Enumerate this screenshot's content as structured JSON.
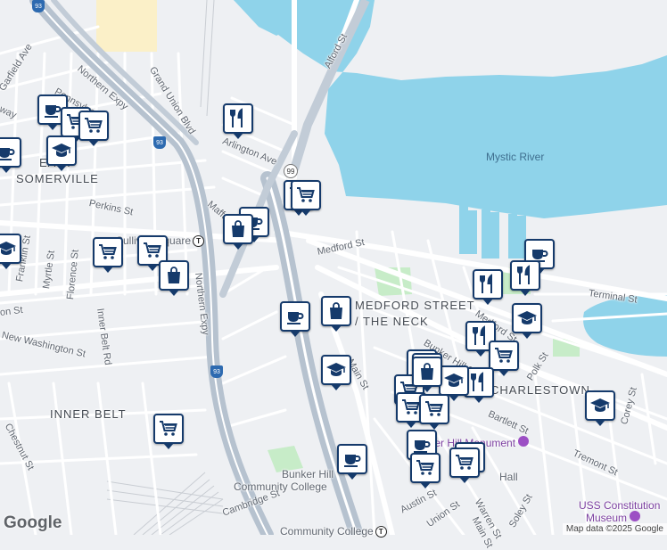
{
  "labels": {
    "mystic_river": "Mystic River",
    "somerville_line1": "EAST",
    "somerville_line2": "SOMERVILLE",
    "inner_belt": "INNER BELT",
    "medford_street_area_line1": "MEDFORD STREET",
    "medford_street_area_line2": "/ THE NECK",
    "charlestown": "CHARLESTOWN",
    "bunker_hill_cc_line1": "Bunker Hill",
    "bunker_hill_cc_line2": "Community College",
    "community_college_station": "Community College",
    "sullivan_square": "Sullivan Square",
    "monument": "Bunker Hill Monument",
    "uss_museum_line1": "USS Constitution",
    "uss_museum_line2": "Museum",
    "city_square_fragment": "Hall",
    "route_99": "99",
    "route_93": "93"
  },
  "streets": {
    "northern_expy_1": "Northern Expy",
    "northern_expy_2": "Northern Expy",
    "grand_union_blvd": "Grand Union Blvd",
    "alford_st": "Alford St",
    "arlington_ave": "Arlington Ave",
    "perkins_st": "Perkins St",
    "garfield_ave": "Garfield Ave",
    "pennsylvania": "Pennsylvania",
    "franklin_st": "Franklin St",
    "myrtle_st": "Myrtle St",
    "florence_st": "Florence St",
    "inner_belt_rd": "Inner Belt Rd",
    "new_washington_st": "New Washington St",
    "washington_st": "on St",
    "medford_st": "Medford St",
    "medford_st_2": "Medford St",
    "bunker_hill_st": "Bunker Hill St",
    "main_st": "Main St",
    "main_st_2": "Main St",
    "terminal_st": "Terminal St",
    "polk_st": "Polk St",
    "bartlett_st": "Bartlett St",
    "tremont_st": "Tremont St",
    "corey_st": "Corey St",
    "austin_st": "Austin St",
    "union_st": "Union St",
    "warren_st": "Warren St",
    "soley_st": "Soley St",
    "chestnut_st": "Chestnut St",
    "maffa_way": "Maffa",
    "broadway_fragment": "way",
    "cambridge_st": "Cambridge St"
  },
  "pins": [
    {
      "icon": "coffee"
    },
    {
      "icon": "cart"
    },
    {
      "icon": "cart"
    },
    {
      "icon": "school"
    },
    {
      "icon": "restaurant"
    },
    {
      "icon": "cart"
    },
    {
      "icon": "cart"
    },
    {
      "icon": "coffee"
    },
    {
      "icon": "shopping-bag"
    },
    {
      "icon": "cart"
    },
    {
      "icon": "cart"
    },
    {
      "icon": "shopping-bag"
    },
    {
      "icon": "coffee"
    },
    {
      "icon": "shopping-bag"
    },
    {
      "icon": "school"
    },
    {
      "icon": "coffee"
    },
    {
      "icon": "restaurant"
    },
    {
      "icon": "restaurant"
    },
    {
      "icon": "coffee"
    },
    {
      "icon": "school"
    },
    {
      "icon": "restaurant"
    },
    {
      "icon": "cart"
    },
    {
      "icon": "cart"
    },
    {
      "icon": "restaurant"
    },
    {
      "icon": "school"
    },
    {
      "icon": "cart"
    },
    {
      "icon": "shopping-bag"
    },
    {
      "icon": "cart"
    },
    {
      "icon": "cart"
    },
    {
      "icon": "coffee"
    },
    {
      "icon": "cart"
    },
    {
      "icon": "cart"
    },
    {
      "icon": "cart"
    },
    {
      "icon": "school"
    },
    {
      "icon": "cart"
    },
    {
      "icon": "coffee"
    },
    {
      "icon": "school"
    },
    {
      "icon": "coffee"
    }
  ],
  "attribution": "Map data ©2025 Google",
  "logo": "Google",
  "colors": {
    "water": "#8fd3ea",
    "land": "#eef0f3",
    "road": "#ffffff",
    "highway": "#b6c2cf",
    "park": "#c7ecc8",
    "industrial": "#fbf0c8",
    "pin_border": "#153a6b"
  }
}
